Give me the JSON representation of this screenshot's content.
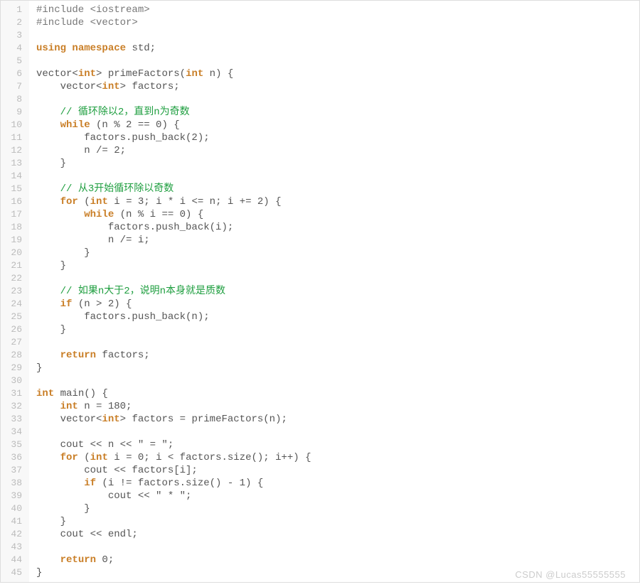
{
  "watermark": "CSDN @Lucas55555555",
  "lines": [
    {
      "num": "1",
      "tokens": [
        {
          "t": "#include ",
          "c": "preproc"
        },
        {
          "t": "<iostream>",
          "c": "include-target"
        }
      ]
    },
    {
      "num": "2",
      "tokens": [
        {
          "t": "#include ",
          "c": "preproc"
        },
        {
          "t": "<vector>",
          "c": "include-target"
        }
      ]
    },
    {
      "num": "3",
      "tokens": []
    },
    {
      "num": "4",
      "tokens": [
        {
          "t": "using",
          "c": "keyword"
        },
        {
          "t": " ",
          "c": "punct"
        },
        {
          "t": "namespace",
          "c": "keyword"
        },
        {
          "t": " std;",
          "c": "punct"
        }
      ]
    },
    {
      "num": "5",
      "tokens": []
    },
    {
      "num": "6",
      "tokens": [
        {
          "t": "vector<",
          "c": "identifier"
        },
        {
          "t": "int",
          "c": "type"
        },
        {
          "t": "> primeFactors(",
          "c": "identifier"
        },
        {
          "t": "int",
          "c": "type"
        },
        {
          "t": " n) {",
          "c": "punct"
        }
      ]
    },
    {
      "num": "7",
      "tokens": [
        {
          "t": "    vector<",
          "c": "identifier"
        },
        {
          "t": "int",
          "c": "type"
        },
        {
          "t": "> factors;",
          "c": "punct"
        }
      ]
    },
    {
      "num": "8",
      "tokens": []
    },
    {
      "num": "9",
      "tokens": [
        {
          "t": "    ",
          "c": "punct"
        },
        {
          "t": "// 循环除以2，直到n为奇数",
          "c": "comment"
        }
      ]
    },
    {
      "num": "10",
      "tokens": [
        {
          "t": "    ",
          "c": "punct"
        },
        {
          "t": "while",
          "c": "keyword"
        },
        {
          "t": " (n % 2 == 0) {",
          "c": "punct"
        }
      ]
    },
    {
      "num": "11",
      "tokens": [
        {
          "t": "        factors.push_back(2);",
          "c": "identifier"
        }
      ]
    },
    {
      "num": "12",
      "tokens": [
        {
          "t": "        n /= 2;",
          "c": "identifier"
        }
      ]
    },
    {
      "num": "13",
      "tokens": [
        {
          "t": "    }",
          "c": "punct"
        }
      ]
    },
    {
      "num": "14",
      "tokens": []
    },
    {
      "num": "15",
      "tokens": [
        {
          "t": "    ",
          "c": "punct"
        },
        {
          "t": "// 从3开始循环除以奇数",
          "c": "comment"
        }
      ]
    },
    {
      "num": "16",
      "tokens": [
        {
          "t": "    ",
          "c": "punct"
        },
        {
          "t": "for",
          "c": "keyword"
        },
        {
          "t": " (",
          "c": "punct"
        },
        {
          "t": "int",
          "c": "type"
        },
        {
          "t": " i = 3; i * i <= n; i += 2) {",
          "c": "punct"
        }
      ]
    },
    {
      "num": "17",
      "tokens": [
        {
          "t": "        ",
          "c": "punct"
        },
        {
          "t": "while",
          "c": "keyword"
        },
        {
          "t": " (n % i == 0) {",
          "c": "punct"
        }
      ]
    },
    {
      "num": "18",
      "tokens": [
        {
          "t": "            factors.push_back(i);",
          "c": "identifier"
        }
      ]
    },
    {
      "num": "19",
      "tokens": [
        {
          "t": "            n /= i;",
          "c": "identifier"
        }
      ]
    },
    {
      "num": "20",
      "tokens": [
        {
          "t": "        }",
          "c": "punct"
        }
      ]
    },
    {
      "num": "21",
      "tokens": [
        {
          "t": "    }",
          "c": "punct"
        }
      ]
    },
    {
      "num": "22",
      "tokens": []
    },
    {
      "num": "23",
      "tokens": [
        {
          "t": "    ",
          "c": "punct"
        },
        {
          "t": "// 如果n大于2，说明n本身就是质数",
          "c": "comment"
        }
      ]
    },
    {
      "num": "24",
      "tokens": [
        {
          "t": "    ",
          "c": "punct"
        },
        {
          "t": "if",
          "c": "keyword"
        },
        {
          "t": " (n > 2) {",
          "c": "punct"
        }
      ]
    },
    {
      "num": "25",
      "tokens": [
        {
          "t": "        factors.push_back(n);",
          "c": "identifier"
        }
      ]
    },
    {
      "num": "26",
      "tokens": [
        {
          "t": "    }",
          "c": "punct"
        }
      ]
    },
    {
      "num": "27",
      "tokens": []
    },
    {
      "num": "28",
      "tokens": [
        {
          "t": "    ",
          "c": "punct"
        },
        {
          "t": "return",
          "c": "keyword"
        },
        {
          "t": " factors;",
          "c": "punct"
        }
      ]
    },
    {
      "num": "29",
      "tokens": [
        {
          "t": "}",
          "c": "punct"
        }
      ]
    },
    {
      "num": "30",
      "tokens": []
    },
    {
      "num": "31",
      "tokens": [
        {
          "t": "int",
          "c": "type"
        },
        {
          "t": " main() {",
          "c": "punct"
        }
      ]
    },
    {
      "num": "32",
      "tokens": [
        {
          "t": "    ",
          "c": "punct"
        },
        {
          "t": "int",
          "c": "type"
        },
        {
          "t": " n = 180;",
          "c": "punct"
        }
      ]
    },
    {
      "num": "33",
      "tokens": [
        {
          "t": "    vector<",
          "c": "identifier"
        },
        {
          "t": "int",
          "c": "type"
        },
        {
          "t": "> factors = primeFactors(n);",
          "c": "punct"
        }
      ]
    },
    {
      "num": "34",
      "tokens": []
    },
    {
      "num": "35",
      "tokens": [
        {
          "t": "    cout << n << ",
          "c": "identifier"
        },
        {
          "t": "\" = \"",
          "c": "string"
        },
        {
          "t": ";",
          "c": "punct"
        }
      ]
    },
    {
      "num": "36",
      "tokens": [
        {
          "t": "    ",
          "c": "punct"
        },
        {
          "t": "for",
          "c": "keyword"
        },
        {
          "t": " (",
          "c": "punct"
        },
        {
          "t": "int",
          "c": "type"
        },
        {
          "t": " i = 0; i < factors.size(); i++) {",
          "c": "punct"
        }
      ]
    },
    {
      "num": "37",
      "tokens": [
        {
          "t": "        cout << factors[i];",
          "c": "identifier"
        }
      ]
    },
    {
      "num": "38",
      "tokens": [
        {
          "t": "        ",
          "c": "punct"
        },
        {
          "t": "if",
          "c": "keyword"
        },
        {
          "t": " (i != factors.size() - 1) {",
          "c": "punct"
        }
      ]
    },
    {
      "num": "39",
      "tokens": [
        {
          "t": "            cout << ",
          "c": "identifier"
        },
        {
          "t": "\" * \"",
          "c": "string"
        },
        {
          "t": ";",
          "c": "punct"
        }
      ]
    },
    {
      "num": "40",
      "tokens": [
        {
          "t": "        }",
          "c": "punct"
        }
      ]
    },
    {
      "num": "41",
      "tokens": [
        {
          "t": "    }",
          "c": "punct"
        }
      ]
    },
    {
      "num": "42",
      "tokens": [
        {
          "t": "    cout << endl;",
          "c": "identifier"
        }
      ]
    },
    {
      "num": "43",
      "tokens": []
    },
    {
      "num": "44",
      "tokens": [
        {
          "t": "    ",
          "c": "punct"
        },
        {
          "t": "return",
          "c": "keyword"
        },
        {
          "t": " 0;",
          "c": "punct"
        }
      ]
    },
    {
      "num": "45",
      "tokens": [
        {
          "t": "}",
          "c": "punct"
        }
      ]
    }
  ]
}
